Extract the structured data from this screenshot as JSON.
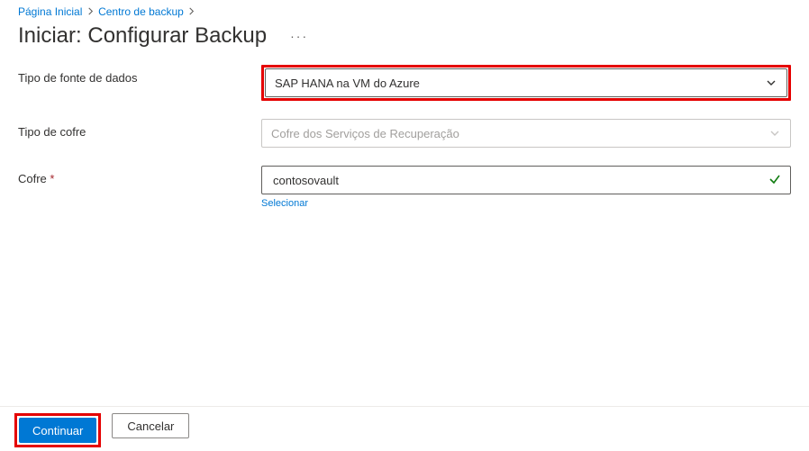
{
  "breadcrumb": {
    "home": "Página Inicial",
    "center": "Centro de backup"
  },
  "title": "Iniciar: Configurar Backup",
  "fields": {
    "datasource": {
      "label": "Tipo de fonte de dados",
      "value": "SAP HANA na VM do Azure"
    },
    "vaultType": {
      "label": "Tipo de cofre",
      "value": "Cofre dos Serviços de Recuperação"
    },
    "vault": {
      "label": "Cofre",
      "value": "contosovault",
      "selectLink": "Selecionar"
    }
  },
  "footer": {
    "continue": "Continuar",
    "cancel": "Cancelar"
  }
}
